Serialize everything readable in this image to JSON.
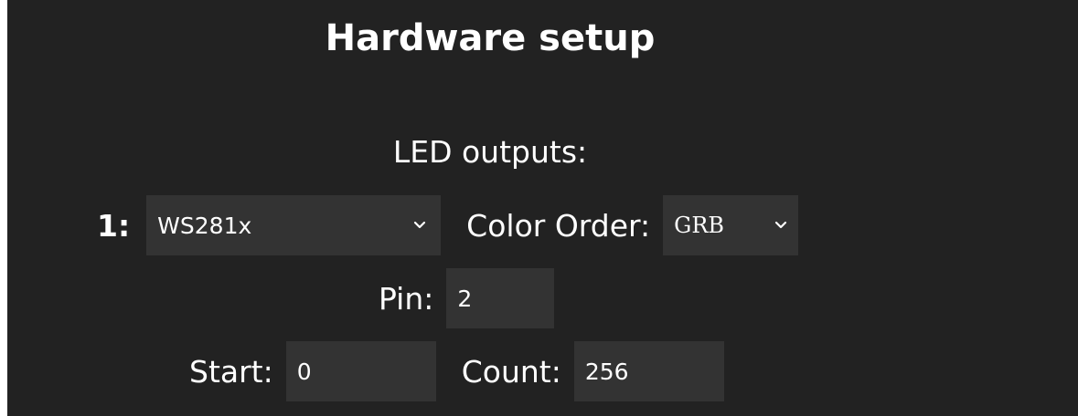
{
  "page": {
    "title": "Hardware setup",
    "section_label": "LED outputs:"
  },
  "output": {
    "index_label": "1:",
    "led_type": {
      "value": "WS281x"
    },
    "color_order": {
      "label": "Color Order:",
      "value": "GRB"
    },
    "pin": {
      "label": "Pin:",
      "value": "2"
    },
    "start": {
      "label": "Start:",
      "value": "0"
    },
    "count": {
      "label": "Count:",
      "value": "256"
    }
  },
  "icons": {
    "dropdown": "chevron-down-icon"
  },
  "colors": {
    "background": "#222222",
    "field_background": "#333333",
    "text": "#ffffff"
  }
}
